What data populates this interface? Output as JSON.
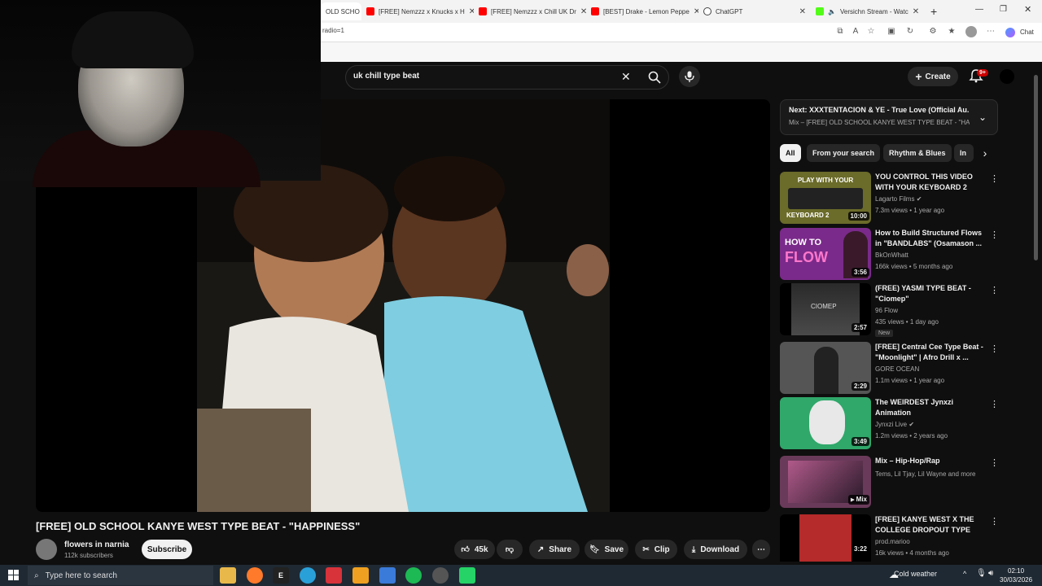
{
  "browser": {
    "tabs": [
      {
        "label": "OLD SCHO",
        "favicon_color": "#ff0000"
      },
      {
        "label": "[FREE] Nemzzz x Knucks x H",
        "favicon_color": "#ff0000"
      },
      {
        "label": "[FREE] Nemzzz x Chill UK Dr",
        "favicon_color": "#ff0000"
      },
      {
        "label": "[BEST] Drake - Lemon Peppe",
        "favicon_color": "#ff0000"
      },
      {
        "label": "ChatGPT",
        "favicon_color": "#444444"
      },
      {
        "label": "Versichn Stream - Watc",
        "favicon_color": "#53fc18"
      }
    ],
    "address": "radio=1",
    "chat_label": "Chat"
  },
  "search": {
    "query": "uk chill type beat"
  },
  "header": {
    "create_label": "Create",
    "notif_count": "9+"
  },
  "video": {
    "title": "[FREE] OLD SCHOOL KANYE WEST TYPE BEAT - \"HAPPINESS\"",
    "channel": "flowers in narnia",
    "subscribers": "112k subscribers",
    "subscribe_label": "Subscribe",
    "likes": "45k",
    "share_label": "Share",
    "save_label": "Save",
    "clip_label": "Clip",
    "download_label": "Download"
  },
  "next_up": {
    "title": "Next: XXXTENTACION & YE - True Love (Official Au...",
    "subtitle": "Mix – [FREE] OLD SCHOOL KANYE WEST TYPE BEAT - \"HAP..."
  },
  "chips": [
    "All",
    "From your search",
    "Rhythm & Blues",
    "In"
  ],
  "recommendations": [
    {
      "title": "YOU CONTROL THIS VIDEO WITH YOUR KEYBOARD 2",
      "channel": "Lagarto Films",
      "verified": true,
      "meta": "7.3m views • 1 year ago",
      "duration": "10:00",
      "thumb_text": "PLAY WITH YOUR",
      "thumb_text2": "KEYBOARD 2",
      "color": "#6b6b2a"
    },
    {
      "title": "How to Build Structured Flows in \"BANDLABS\" (Osamason ...",
      "channel": "BkOnWhatt",
      "verified": false,
      "meta": "166k views • 5 months ago",
      "duration": "3:56",
      "thumb_text": "HOW TO",
      "thumb_text2": "FLOW",
      "color": "#7a2a8a"
    },
    {
      "title": "(FREE) YASMI TYPE BEAT - \"Ciomep\"",
      "channel": "96 Flow",
      "verified": false,
      "meta": "435 views • 1 day ago",
      "duration": "2:57",
      "badge": "New",
      "thumb_text": "CIOMEP",
      "thumb_text2": "",
      "color": "#3a3a3a"
    },
    {
      "title": "[FREE] Central Cee Type Beat - \"Moonlight\" | Afro Drill x ...",
      "channel": "GORE OCEAN",
      "verified": false,
      "meta": "1.1m views • 1 year ago",
      "duration": "2:29",
      "thumb_text": "",
      "thumb_text2": "",
      "color": "#555555"
    },
    {
      "title": "The WEIRDEST Jynxzi Animation",
      "channel": "Jynxzi Live",
      "verified": true,
      "meta": "1.2m views • 2 years ago",
      "duration": "3:49",
      "thumb_text": "",
      "thumb_text2": "",
      "color": "#2fa86a"
    },
    {
      "title": "Mix – Hip-Hop/Rap",
      "channel": "Tems, Lil Tjay, Lil Wayne and more",
      "verified": false,
      "meta": "",
      "duration": "Mix",
      "thumb_text": "",
      "thumb_text2": "",
      "color": "#6a3a5a"
    },
    {
      "title": "[FREE] KANYE WEST X THE COLLEGE DROPOUT TYPE BE...",
      "channel": "prod.marioo",
      "verified": false,
      "meta": "16k views • 4 months ago",
      "duration": "3:22",
      "thumb_text": "",
      "thumb_text2": "",
      "color": "#b52a2a"
    }
  ],
  "taskbar": {
    "search_placeholder": "Type here to search",
    "weather": "Cold weather",
    "time": "02:10",
    "date": "30/03/2026"
  }
}
